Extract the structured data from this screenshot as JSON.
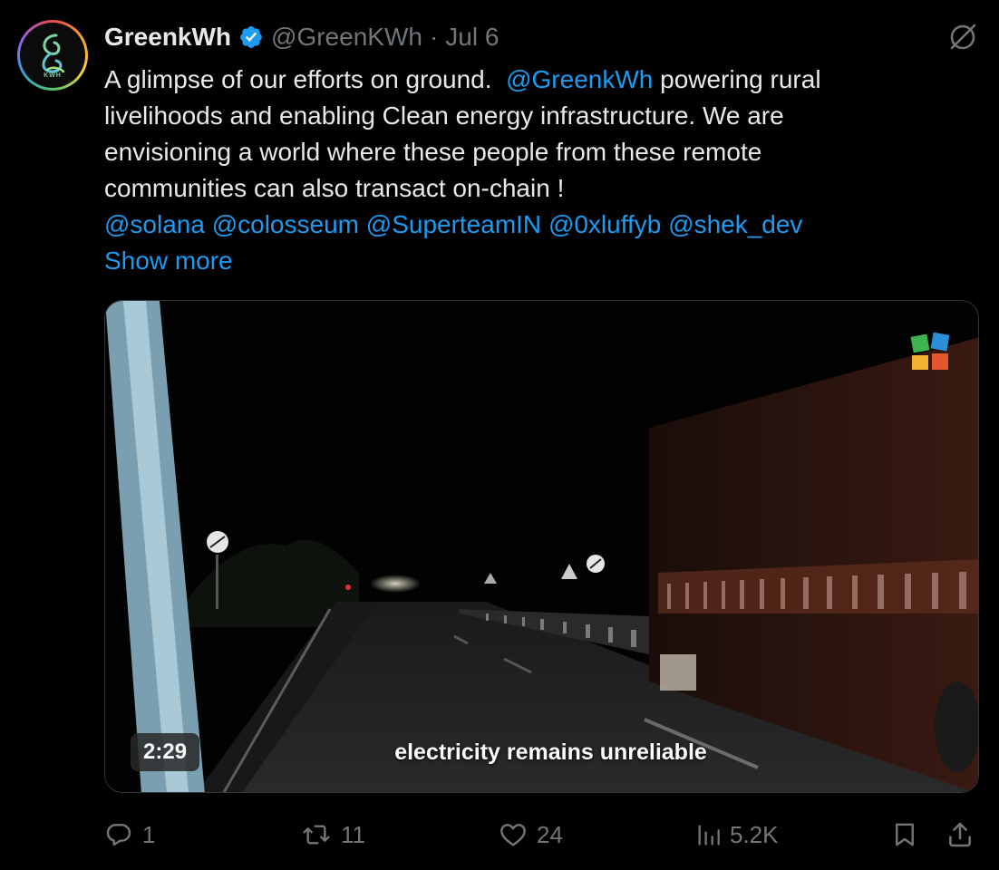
{
  "author": {
    "display_name": "GreenkWh",
    "handle": "@GreenKWh",
    "separator": "·",
    "date": "Jul 6",
    "avatar_text": "KWH"
  },
  "tweet": {
    "line1_text": "A glimpse of our efforts on ground.",
    "line1_mention": "@GreenkWh",
    "line1_rest": " powering rural",
    "line2": "livelihoods and enabling Clean energy infrastructure. We are",
    "line3": "envisioning a world where these people from these remote",
    "line4": "communities can also transact on-chain !",
    "mentions": [
      "@solana",
      "@colosseum",
      "@SuperteamIN",
      "@0xluffyb",
      "@shek_dev"
    ],
    "show_more": "Show more"
  },
  "media": {
    "duration": "2:29",
    "subtitle": "electricity remains unreliable"
  },
  "actions": {
    "replies": "1",
    "reposts": "11",
    "likes": "24",
    "views": "5.2K"
  },
  "colors": {
    "accent": "#1d9bf0",
    "muted": "#71767b",
    "text": "#e7e9ea",
    "background": "#000000"
  },
  "icons": {
    "verified": "verified-badge-icon",
    "grok": "grok-icon",
    "reply": "reply-icon",
    "repost": "repost-icon",
    "like": "heart-icon",
    "views": "views-icon",
    "bookmark": "bookmark-icon",
    "share": "share-icon"
  }
}
